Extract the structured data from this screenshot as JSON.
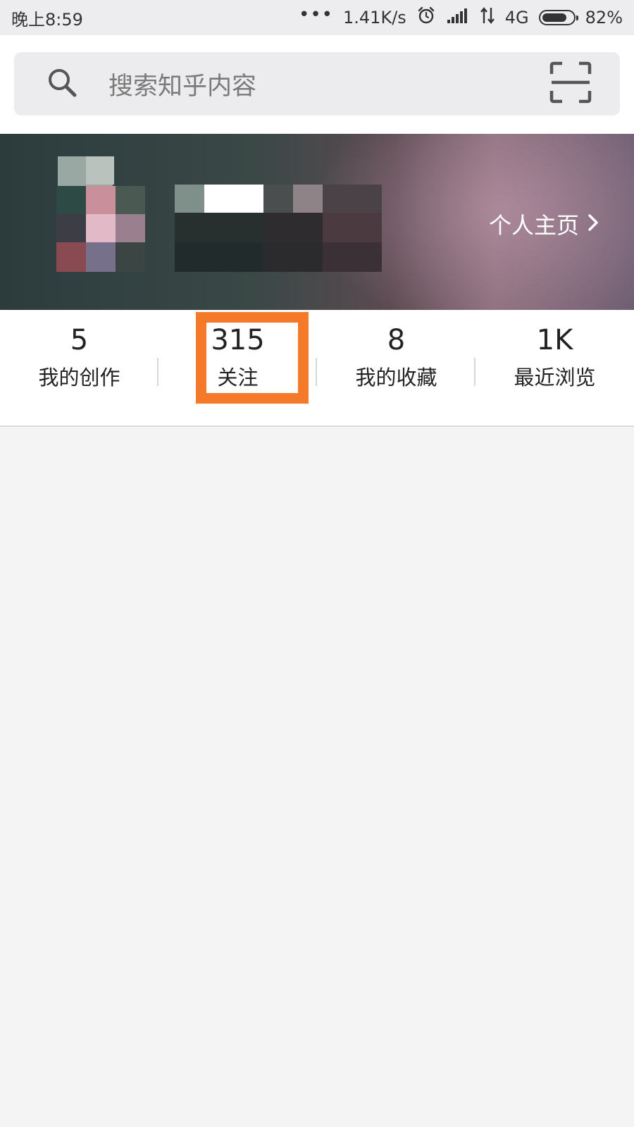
{
  "status_bar": {
    "time": "晚上8:59",
    "dots": "•••",
    "net_speed": "1.41K/s",
    "data_label": "4G",
    "battery_percent": "82%",
    "battery_level": 0.82
  },
  "search": {
    "placeholder": "搜索知乎内容"
  },
  "profile": {
    "homepage_link": "个人主页"
  },
  "stats": [
    {
      "value": "5",
      "label": "我的创作"
    },
    {
      "value": "315",
      "label": "关注"
    },
    {
      "value": "8",
      "label": "我的收藏"
    },
    {
      "value": "1K",
      "label": "最近浏览"
    }
  ],
  "colors": {
    "highlight": "#f47a2a",
    "status_bar_bg": "#ededf0",
    "page_bg": "#f4f4f5"
  }
}
